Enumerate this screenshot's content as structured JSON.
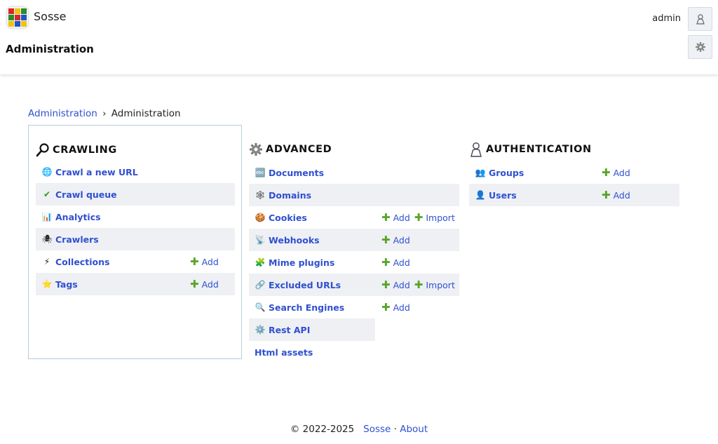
{
  "app": {
    "name": "Sosse",
    "page_title": "Administration",
    "user": "admin"
  },
  "breadcrumb": {
    "root": "Administration",
    "separator": "›",
    "current": "Administration"
  },
  "crawling": {
    "title": "CRAWLING",
    "rows": [
      {
        "icon": "🌐",
        "label": "Crawl a new URL",
        "actions": []
      },
      {
        "icon": "✔",
        "label": "Crawl queue",
        "actions": []
      },
      {
        "icon": "📊",
        "label": "Analytics",
        "actions": []
      },
      {
        "icon": "🕷",
        "label": "Crawlers",
        "actions": []
      },
      {
        "icon": "⚡",
        "label": "Collections",
        "actions": [
          "Add"
        ]
      },
      {
        "icon": "⭐",
        "label": "Tags",
        "actions": [
          "Add"
        ]
      }
    ]
  },
  "advanced": {
    "title": "ADVANCED",
    "rows": [
      {
        "icon": "🔤",
        "label": "Documents",
        "actions": []
      },
      {
        "icon": "🕸",
        "label": "Domains",
        "actions": []
      },
      {
        "icon": "🍪",
        "label": "Cookies",
        "actions": [
          "Add",
          "Import"
        ]
      },
      {
        "icon": "📡",
        "label": "Webhooks",
        "actions": [
          "Add"
        ]
      },
      {
        "icon": "🧩",
        "label": "Mime plugins",
        "actions": [
          "Add"
        ]
      },
      {
        "icon": "🔗",
        "label": "Excluded URLs",
        "actions": [
          "Add",
          "Import"
        ]
      },
      {
        "icon": "🔍",
        "label": "Search Engines",
        "actions": [
          "Add"
        ]
      },
      {
        "icon": "⚙️",
        "label": "Rest API",
        "actions": []
      },
      {
        "icon": "",
        "label": "Html assets",
        "actions": []
      }
    ]
  },
  "authentication": {
    "title": "AUTHENTICATION",
    "rows": [
      {
        "icon": "👥",
        "label": "Groups",
        "actions": [
          "Add"
        ]
      },
      {
        "icon": "👤",
        "label": "Users",
        "actions": [
          "Add"
        ]
      }
    ]
  },
  "footer": {
    "copyright": "© 2022-2025",
    "brand": "Sosse",
    "dot": "·",
    "about": "About"
  },
  "colors": {
    "link": "#3050d0",
    "plus": "#5aa52c",
    "row_alt": "#eef0f4",
    "panel_border": "#b7ccd9"
  }
}
